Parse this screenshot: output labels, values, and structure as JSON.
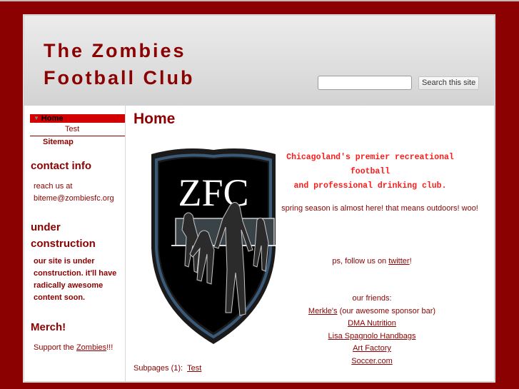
{
  "header": {
    "title_line1": "The Zombies",
    "title_line2": "Football Club",
    "search_placeholder": "",
    "search_value": "",
    "search_button": "Search this site"
  },
  "sidebar": {
    "nav": [
      {
        "label": "Home",
        "active": true,
        "icon": "triangle-down-icon"
      },
      {
        "label": "Test",
        "active": false
      },
      {
        "label": "Sitemap",
        "active": false
      }
    ],
    "sections": [
      {
        "heading": "contact info",
        "lines": [
          "reach us at",
          "biteme@zombiesfc.org"
        ]
      },
      {
        "heading_line1": "under",
        "heading_line2": "construction",
        "lines": [
          "our site is under",
          "construction.  it'll have",
          "radically awesome",
          "content soon."
        ]
      },
      {
        "heading": "Merch!",
        "text_before": "Support the ",
        "link": "Zombies",
        "text_after": "!!!"
      }
    ]
  },
  "main": {
    "page_title": "Home",
    "crest_text": "ZFC",
    "promo_lines": [
      "Chicagoland's premier recreational",
      "football",
      "and professional drinking club."
    ],
    "spring_text": "spring season is almost here! that means outdoors! woo!",
    "twitter_before": "ps, follow us on ",
    "twitter_link": "twitter",
    "twitter_after": "!",
    "friends_label": "our friends:",
    "friends": [
      {
        "link": "Merkle's",
        "suffix": " (our awesome sponsor bar)"
      },
      {
        "link": "DMA Nutrition",
        "suffix": ""
      },
      {
        "link": "Lisa Spagnolo Handbags",
        "suffix": ""
      },
      {
        "link": "Art Factory",
        "suffix": ""
      },
      {
        "link": "Soccer.com",
        "suffix": ""
      }
    ],
    "subpages_label": "Subpages (1):",
    "subpages_link": "Test"
  },
  "colors": {
    "brand": "#8b0000",
    "nav_active": "#d20000",
    "promo": "#ff1a1a"
  }
}
